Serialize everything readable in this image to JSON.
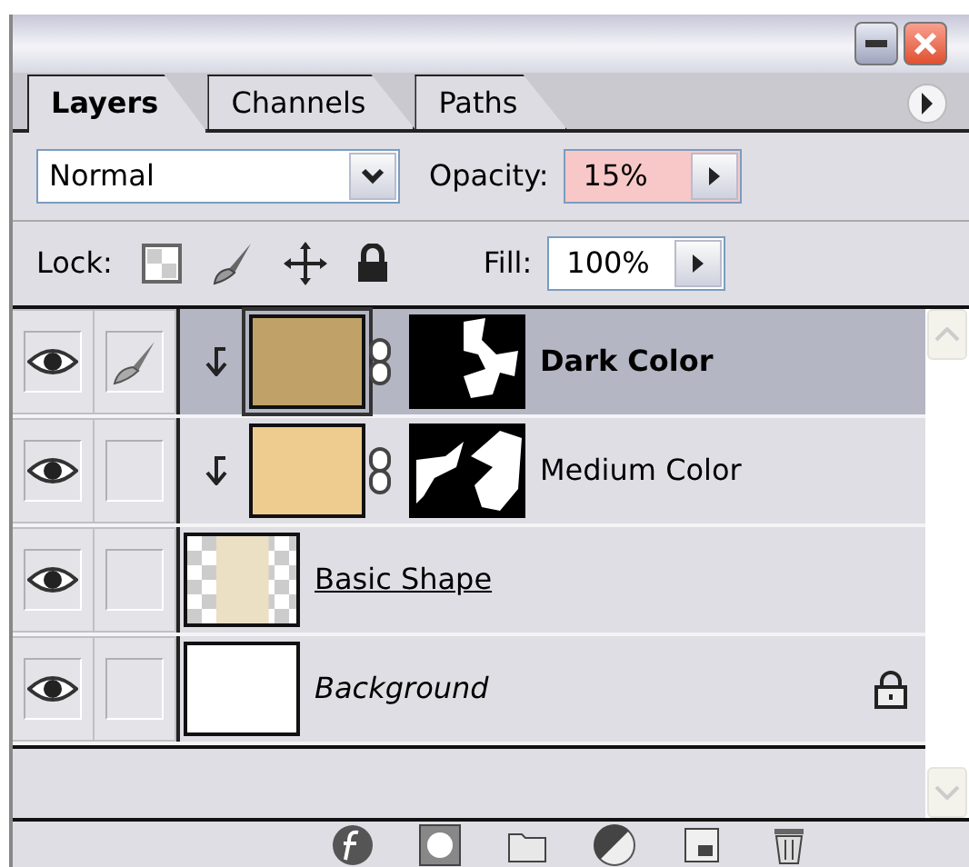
{
  "tabs": [
    {
      "label": "Layers",
      "selected": true
    },
    {
      "label": "Channels",
      "selected": false
    },
    {
      "label": "Paths",
      "selected": false
    }
  ],
  "blend_mode": {
    "value": "Normal"
  },
  "opacity": {
    "label": "Opacity:",
    "value": "15%",
    "highlighted": true
  },
  "lock": {
    "label": "Lock:"
  },
  "fill": {
    "label": "Fill:",
    "value": "100%",
    "highlighted": false
  },
  "layers": [
    {
      "name": "Dark Color",
      "kind": "masked",
      "color": "#c0a268",
      "selected": true,
      "visible": true,
      "clipped": true,
      "clip_base": false,
      "locked": false
    },
    {
      "name": "Medium Color",
      "kind": "masked",
      "color": "#eecb8e",
      "selected": false,
      "visible": true,
      "clipped": true,
      "clip_base": false,
      "locked": false
    },
    {
      "name": "Basic Shape",
      "kind": "transparent",
      "color": "#ebdfc4",
      "selected": false,
      "visible": true,
      "clipped": false,
      "clip_base": true,
      "locked": false
    },
    {
      "name": "Background",
      "kind": "background",
      "color": "#ffffff",
      "selected": false,
      "visible": true,
      "clipped": false,
      "clip_base": false,
      "locked": true
    }
  ]
}
